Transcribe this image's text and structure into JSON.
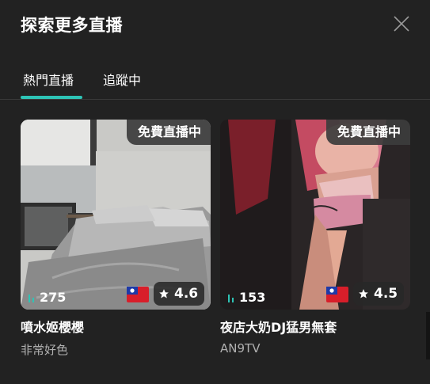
{
  "header": {
    "title": "探索更多直播"
  },
  "tabs": [
    {
      "label": "熱門直播",
      "active": true
    },
    {
      "label": "追蹤中",
      "active": false
    }
  ],
  "accent_color": "#2ec4b6",
  "streams": [
    {
      "badge": "免費直播中",
      "viewers": "275",
      "rating": "4.6",
      "country_flag": "taiwan-flag",
      "title": "噴水姬櫻櫻",
      "streamer": "非常好色"
    },
    {
      "badge": "免費直播中",
      "viewers": "153",
      "rating": "4.5",
      "country_flag": "taiwan-flag",
      "title": "夜店大奶DJ猛男無套",
      "streamer": "AN9TV"
    }
  ]
}
